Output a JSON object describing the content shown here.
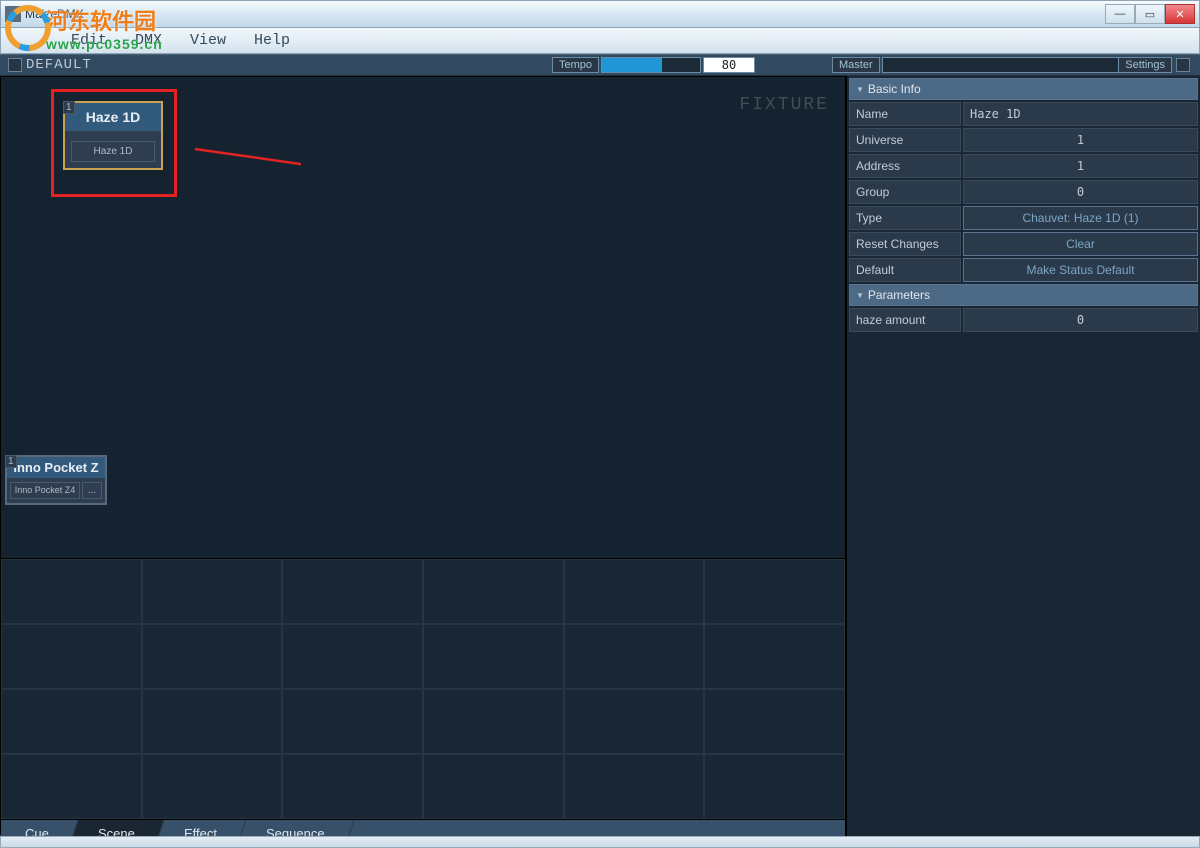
{
  "window": {
    "title": "MaizeDMX"
  },
  "menu": [
    "Edit",
    "DMX",
    "View",
    "Help"
  ],
  "toolbar": {
    "project": "DEFAULT",
    "tempo_label": "Tempo",
    "tempo_value": "80",
    "master_label": "Master",
    "settings_label": "Settings"
  },
  "canvas": {
    "watermark": "FIXTURE",
    "tile1": {
      "corner": "1",
      "title": "Haze 1D",
      "sub": "Haze 1D"
    },
    "tile2": {
      "corner": "1",
      "title": "Inno Pocket Z",
      "sub": "Inno Pocket Z4",
      "dots": "..."
    }
  },
  "tabs": [
    "Cue",
    "Scene",
    "Effect",
    "Sequence"
  ],
  "panel": {
    "basic_header": "Basic Info",
    "rows": {
      "name_label": "Name",
      "name_value": "Haze 1D",
      "universe_label": "Universe",
      "universe_value": "1",
      "address_label": "Address",
      "address_value": "1",
      "group_label": "Group",
      "group_value": "0",
      "type_label": "Type",
      "type_value": "Chauvet: Haze 1D (1)",
      "reset_label": "Reset Changes",
      "reset_btn": "Clear",
      "default_label": "Default",
      "default_btn": "Make Status Default"
    },
    "params_header": "Parameters",
    "param1_label": "haze amount",
    "param1_value": "0"
  },
  "watermark": {
    "cn": "河东软件园",
    "url": "www.pc0359.cn"
  }
}
